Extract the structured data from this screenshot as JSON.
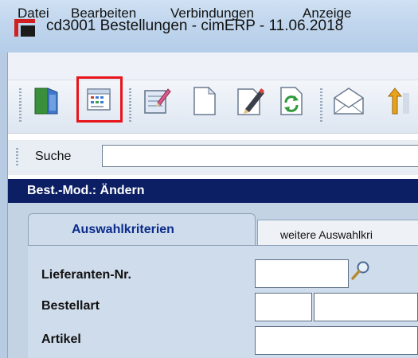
{
  "window": {
    "title": "cd3001 Bestellungen - cimERP - 11.06.2018"
  },
  "menu": {
    "items": [
      "Datei",
      "Bearbeiten",
      "Verbindungen",
      "Anzeige"
    ]
  },
  "toolbar": {
    "buttons": [
      {
        "icon": "exit-door-icon"
      },
      {
        "icon": "calendar-list-icon",
        "highlighted": true
      },
      {
        "icon": "notepad-check-icon"
      },
      {
        "icon": "new-document-icon"
      },
      {
        "icon": "edit-pencil-icon"
      },
      {
        "icon": "refresh-icon"
      },
      {
        "icon": "mail-envelope-icon"
      },
      {
        "icon": "sort-arrows-icon"
      }
    ],
    "highlight_color": "#e8141b"
  },
  "search": {
    "label": "Suche",
    "value": ""
  },
  "module": {
    "title": "Best.-Mod.: Ändern"
  },
  "tabs": [
    {
      "label": "Auswahlkriterien",
      "active": true
    },
    {
      "label": "weitere Auswahlkri",
      "active": false
    }
  ],
  "form": {
    "fields": [
      {
        "label": "Lieferanten-Nr.",
        "value": ""
      },
      {
        "label": "Bestellart",
        "value": ""
      },
      {
        "label": "Artikel",
        "value": ""
      }
    ]
  },
  "colors": {
    "module_bar": "#0c1f64",
    "active_tab_text": "#0a2c8c",
    "panel": "#c3d3e4"
  }
}
